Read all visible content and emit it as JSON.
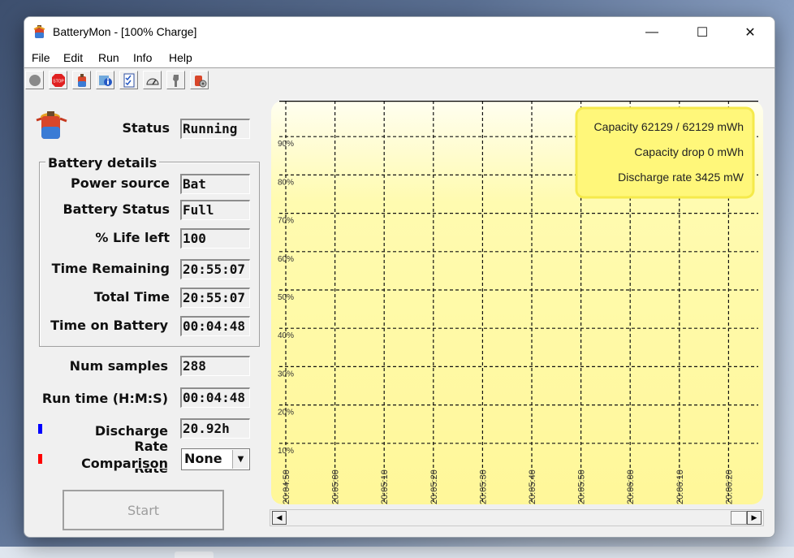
{
  "window": {
    "title": "BatteryMon - [100% Charge]",
    "icon": "battery-app-icon",
    "controls": {
      "minimize": "—",
      "maximize": "☐",
      "close": "✕"
    }
  },
  "menu": [
    "File",
    "Edit",
    "Run",
    "Info",
    "Help"
  ],
  "toolbar": {
    "buttons": [
      "record-icon",
      "stop-icon",
      "battery-icon",
      "info-icon",
      "checklist-icon",
      "gauge-icon",
      "tool-icon",
      "settings-icon"
    ],
    "stop_text": "STOP"
  },
  "status": {
    "label": "Status",
    "value": "Running"
  },
  "battery_details": {
    "title": "Battery details",
    "power_source": {
      "label": "Power source",
      "value": "Bat"
    },
    "battery_status": {
      "label": "Battery Status",
      "value": "Full"
    },
    "life_left": {
      "label": "% Life left",
      "value": "100"
    },
    "time_remaining": {
      "label": "Time Remaining",
      "value": "20:55:07"
    },
    "total_time": {
      "label": "Total Time",
      "value": "20:55:07"
    },
    "time_on_battery": {
      "label": "Time on Battery",
      "value": "00:04:48"
    }
  },
  "num_samples": {
    "label": "Num samples",
    "value": "288"
  },
  "run_time": {
    "label": "Run time (H:M:S)",
    "value": "00:04:48"
  },
  "discharge_rate": {
    "label": "Discharge Rate",
    "value": "20.92h",
    "marker_color": "#0000ff"
  },
  "comparison": {
    "label": "Comparison",
    "selected": "None",
    "marker_color": "#ff0000",
    "overflow_label": "Rate"
  },
  "start_button": {
    "label": "Start",
    "enabled": false
  },
  "chart_data": {
    "type": "line",
    "y_ticks": [
      "90%",
      "80%",
      "70%",
      "60%",
      "50%",
      "40%",
      "30%",
      "20%",
      "10%"
    ],
    "ylim": [
      0,
      100
    ],
    "x_ticks": [
      "20:04:50",
      "20:05:00",
      "20:05:10",
      "20:05:20",
      "20:05:30",
      "20:05:40",
      "20:05:50",
      "20:06:00",
      "20:06:10",
      "20:06:20"
    ],
    "grid": true,
    "background": "#fffbb0",
    "series": [
      {
        "color": "#000000",
        "values": [
          100,
          100,
          100,
          100,
          100,
          100,
          100,
          100,
          100,
          100
        ]
      }
    ],
    "info_box": {
      "placement": "top-right",
      "lines": [
        "Capacity 62129 / 62129 mWh",
        "Capacity drop 0 mWh",
        "Discharge rate 3425 mW"
      ]
    }
  }
}
